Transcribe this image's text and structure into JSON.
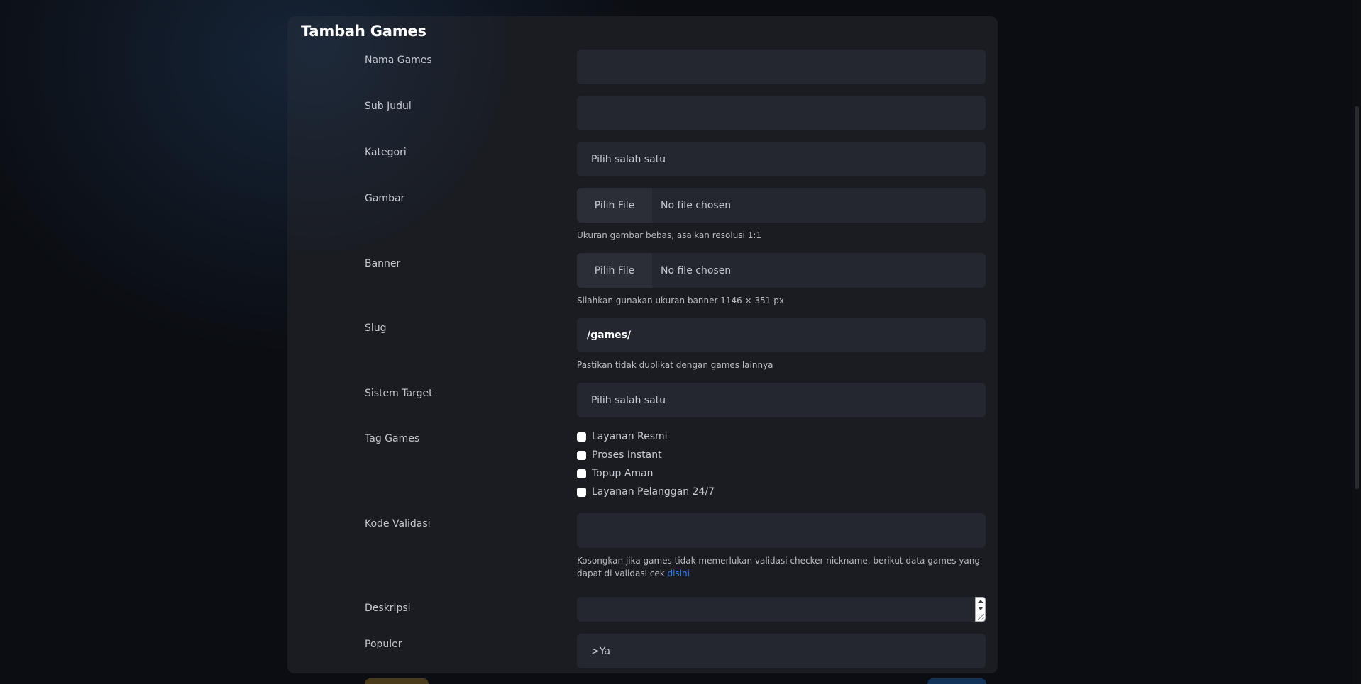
{
  "page": {
    "title": "Tambah Games"
  },
  "form": {
    "nama_games": {
      "label": "Nama Games",
      "value": ""
    },
    "sub_judul": {
      "label": "Sub Judul",
      "value": ""
    },
    "kategori": {
      "label": "Kategori",
      "selected": "Pilih salah satu"
    },
    "gambar": {
      "label": "Gambar",
      "button": "Pilih File",
      "status": "No file chosen",
      "help": "Ukuran gambar bebas, asalkan resolusi 1:1"
    },
    "banner": {
      "label": "Banner",
      "button": "Pilih File",
      "status": "No file chosen",
      "help": "Silahkan gunakan ukuran banner 1146 × 351 px"
    },
    "slug": {
      "label": "Slug",
      "value": "/games/",
      "help": "Pastikan tidak duplikat dengan games lainnya"
    },
    "sistem_target": {
      "label": "Sistem Target",
      "selected": "Pilih salah satu"
    },
    "tag_games": {
      "label": "Tag Games",
      "options": [
        {
          "label": "Layanan Resmi",
          "checked": false
        },
        {
          "label": "Proses Instant",
          "checked": false
        },
        {
          "label": "Topup Aman",
          "checked": false
        },
        {
          "label": "Layanan Pelanggan 24/7",
          "checked": false
        }
      ]
    },
    "kode_validasi": {
      "label": "Kode Validasi",
      "value": "",
      "help_prefix": "Kosongkan jika games tidak memerlukan validasi checker nickname, berikut data games yang dapat di validasi cek",
      "help_link": "disini"
    },
    "deskripsi": {
      "label": "Deskripsi",
      "value": ""
    },
    "populer": {
      "label": "Populer",
      "selected": ">Ya"
    }
  },
  "colors": {
    "page_bg": "#0b0d12",
    "card_bg": "#1a1c22",
    "input_bg": "#252730",
    "link": "#2f7cf6"
  }
}
